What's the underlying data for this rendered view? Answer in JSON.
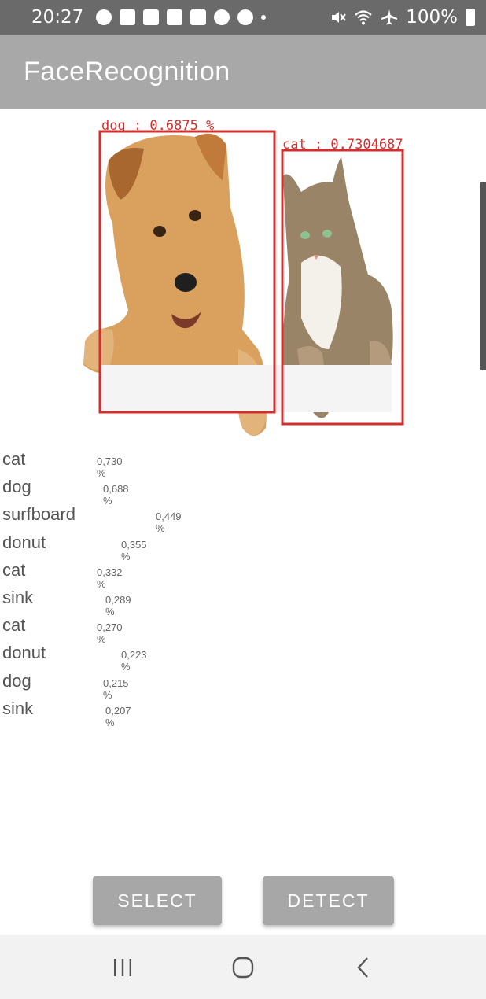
{
  "status_bar": {
    "time": "20:27",
    "battery": "100%",
    "icons": [
      "account-icon",
      "folder-icon",
      "gallery-icon",
      "mail-icon",
      "checkbox-icon",
      "usb-icon",
      "cloud-icon",
      "dot-icon",
      "mute-icon",
      "wifi-icon",
      "airplane-icon",
      "battery-icon"
    ]
  },
  "app_bar": {
    "title": "FaceRecognition"
  },
  "result_image": {
    "boxes": [
      {
        "label": "dog : 0.6875 %",
        "color": "#d32f2f"
      },
      {
        "label": "cat : 0.7304687",
        "color": "#d32f2f"
      }
    ]
  },
  "detections": [
    {
      "label": "cat",
      "score": "0,730 %"
    },
    {
      "label": "dog",
      "score": "0,688 %"
    },
    {
      "label": "surfboard",
      "score": "0,449 %"
    },
    {
      "label": "donut",
      "score": "0,355 %"
    },
    {
      "label": "cat",
      "score": "0,332 %"
    },
    {
      "label": "sink",
      "score": "0,289 %"
    },
    {
      "label": "cat",
      "score": "0,270 %"
    },
    {
      "label": "donut",
      "score": "0,223 %"
    },
    {
      "label": "dog",
      "score": "0,215 %"
    },
    {
      "label": "sink",
      "score": "0,207 %"
    }
  ],
  "buttons": {
    "select": "SELECT",
    "detect": "DETECT"
  },
  "nav_bar": {
    "icons": [
      "recents-icon",
      "home-icon",
      "back-icon"
    ]
  },
  "colors": {
    "app_bar": "#a8a8a8",
    "status_bar": "#6a6a6a",
    "button": "#a7a7a7",
    "box": "#d32f2f"
  }
}
